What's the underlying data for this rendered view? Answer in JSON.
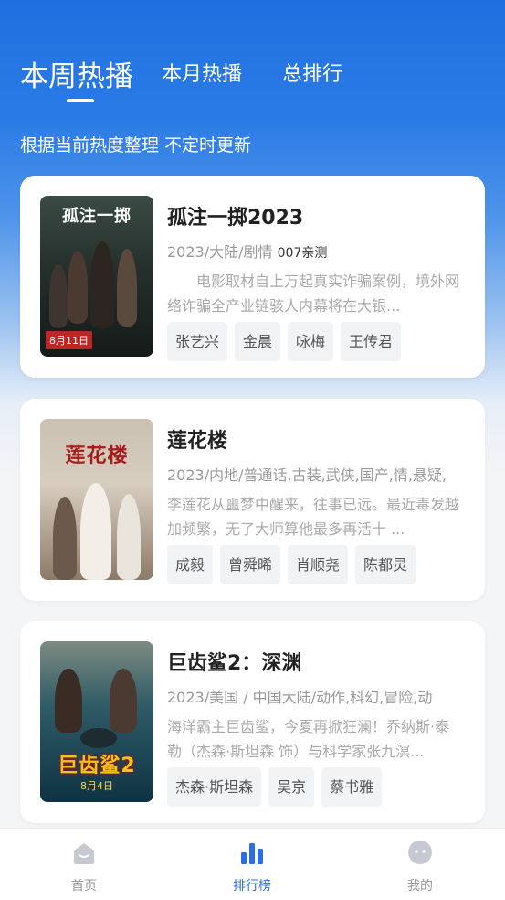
{
  "tabs": [
    {
      "label": "本周热播"
    },
    {
      "label": "本月热播"
    },
    {
      "label": "总排行"
    }
  ],
  "subtitle": "根据当前热度整理 不定时更新",
  "movies": [
    {
      "poster_title": "孤注一掷",
      "poster_date": "8月11日",
      "title": "孤注一掷2023",
      "meta": "2023/大陆/剧情",
      "meta_extra": "007亲测",
      "desc": "　　电影取材自上万起真实诈骗案例，境外网络诈骗全产业链骇人内幕将在大银...",
      "tags": [
        "张艺兴",
        "金晨",
        "咏梅",
        "王传君"
      ]
    },
    {
      "poster_title": "莲花楼",
      "title": "莲花楼",
      "meta": "2023/内地/普通话,古装,武侠,国产,情,悬疑,",
      "desc": "李莲花从噩梦中醒来，往事已远。最近毒发越加频繁，无了大师算他最多再活十 ...",
      "tags": [
        "成毅",
        "曾舜晞",
        "肖顺尧",
        "陈都灵"
      ]
    },
    {
      "poster_title": "巨齿鲨2",
      "poster_date": "8月4日",
      "title": "巨齿鲨2：深渊",
      "meta": "2023/美国 / 中国大陆/动作,科幻,冒险,动",
      "desc": "海洋霸主巨齿鲨，今夏再掀狂澜！乔纳斯·泰勒（杰森·斯坦森 饰）与科学家张九溟...",
      "tags": [
        "杰森·斯坦森",
        "吴京",
        "蔡书雅"
      ]
    }
  ],
  "nav": [
    {
      "label": "首页",
      "icon": "home-icon"
    },
    {
      "label": "排行榜",
      "icon": "ranking-icon"
    },
    {
      "label": "我的",
      "icon": "profile-icon"
    }
  ],
  "colors": {
    "accent": "#2a6fe4",
    "hero_top": "#1f6fe0",
    "text_muted": "#999999"
  }
}
